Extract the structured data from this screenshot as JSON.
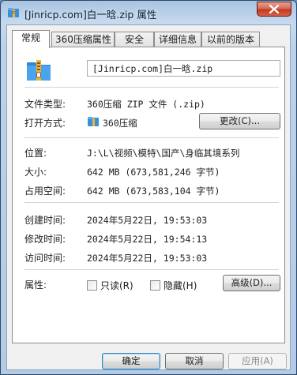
{
  "window": {
    "title": "[Jinricp.com]白一晗.zip 属性"
  },
  "tabs": [
    {
      "label": "常规",
      "active": true
    },
    {
      "label": "360压缩属性",
      "active": false
    },
    {
      "label": "安全",
      "active": false
    },
    {
      "label": "详细信息",
      "active": false
    },
    {
      "label": "以前的版本",
      "active": false
    }
  ],
  "general": {
    "file_name": "[Jinricp.com]白一晗.zip",
    "file_type_label": "文件类型:",
    "file_type_value": "360压缩 ZIP 文件 (.zip)",
    "open_with_label": "打开方式:",
    "open_with_value": "360压缩",
    "change_button": "更改(C)...",
    "location_label": "位置:",
    "location_value": "J:\\L\\视频\\模特\\国产\\身临其境系列",
    "size_label": "大小:",
    "size_value": "642 MB (673,581,246 字节)",
    "size_on_disk_label": "占用空间:",
    "size_on_disk_value": "642 MB (673,583,104 字节)",
    "created_label": "创建时间:",
    "created_value": "2024年5月22日, 19:53:03",
    "modified_label": "修改时间:",
    "modified_value": "2024年5月22日, 19:54:13",
    "accessed_label": "访问时间:",
    "accessed_value": "2024年5月22日, 19:53:03",
    "attributes_label": "属性:",
    "readonly_label": "只读(R)",
    "hidden_label": "隐藏(H)",
    "advanced_button": "高级(D)..."
  },
  "buttons": {
    "ok": "确定",
    "cancel": "取消",
    "apply": "应用(A)"
  },
  "icons": {
    "app": "zip-archive-icon",
    "close": "close-icon",
    "file": "zip-file-icon",
    "open_with": "360zip-icon"
  },
  "colors": {
    "close_red": "#c23a20",
    "titlebar": "#a9c4e1",
    "default_button_border": "#3c7fb1"
  }
}
